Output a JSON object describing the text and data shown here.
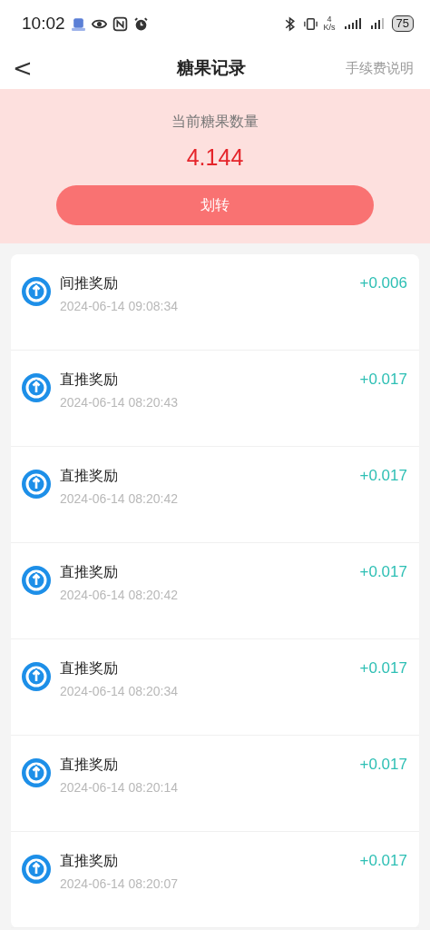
{
  "status_bar": {
    "time": "10:02",
    "net_speed_value": "4",
    "net_speed_unit": "K/s",
    "battery": "75"
  },
  "nav": {
    "back": "<",
    "title": "糖果记录",
    "action": "手续费说明"
  },
  "summary": {
    "label": "当前糖果数量",
    "amount": "4.144",
    "button": "划转"
  },
  "records": [
    {
      "title": "间推奖励",
      "time": "2024-06-14 09:08:34",
      "amount": "+0.006"
    },
    {
      "title": "直推奖励",
      "time": "2024-06-14 08:20:43",
      "amount": "+0.017"
    },
    {
      "title": "直推奖励",
      "time": "2024-06-14 08:20:42",
      "amount": "+0.017"
    },
    {
      "title": "直推奖励",
      "time": "2024-06-14 08:20:42",
      "amount": "+0.017"
    },
    {
      "title": "直推奖励",
      "time": "2024-06-14 08:20:34",
      "amount": "+0.017"
    },
    {
      "title": "直推奖励",
      "time": "2024-06-14 08:20:14",
      "amount": "+0.017"
    },
    {
      "title": "直推奖励",
      "time": "2024-06-14 08:20:07",
      "amount": "+0.017"
    }
  ]
}
